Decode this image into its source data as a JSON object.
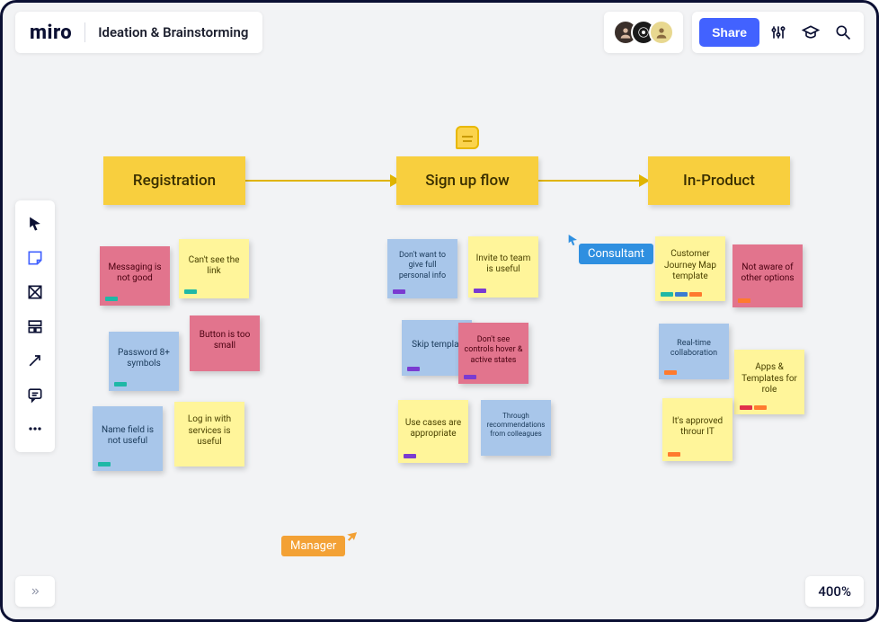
{
  "header": {
    "logo": "miro",
    "board_name": "Ideation & Brainstorming",
    "share_label": "Share"
  },
  "columns": {
    "c1": "Registration",
    "c2": "Sign up flow",
    "c3": "In-Product"
  },
  "notes": {
    "reg": {
      "n1": "Messaging is not good",
      "n2": "Can't see the link",
      "n3": "Button is too small",
      "n4": "Password 8+ symbols",
      "n5": "Name field is not useful",
      "n6": "Log in with services is useful"
    },
    "signup": {
      "n1": "Don't want to give full personal info",
      "n2": "Invite to team is useful",
      "n3": "Skip templat",
      "n4": "Don't see controls hover & active states",
      "n5": "Use cases are appropriate",
      "n6": "Through recommendations from colleagues"
    },
    "product": {
      "n1": "Customer Journey Map template",
      "n2": "Not aware of other options",
      "n3": "Real-time collaboration",
      "n4": "Apps & Templates for role",
      "n5": "It's approved throur IT"
    }
  },
  "cursors": {
    "consultant": "Consultant",
    "manager": "Manager"
  },
  "zoom": "400%",
  "colors": {
    "accent_blue": "#4262ff",
    "sticky_yellow": "#fff59a",
    "sticky_blue": "#a8c6ea",
    "sticky_pink": "#e2748d",
    "header_yellow": "#f8cf3e",
    "cursor_blue": "#2f8fe0",
    "cursor_orange": "#f3a135"
  }
}
